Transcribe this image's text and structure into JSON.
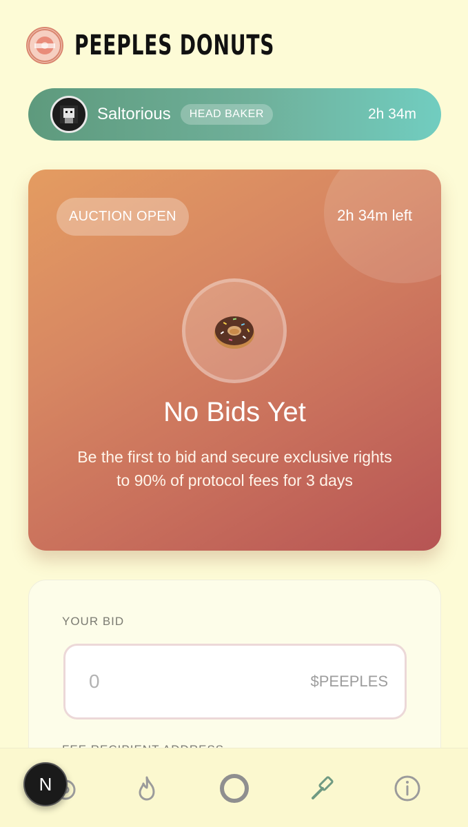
{
  "header": {
    "title": "PEEPLES DONUTS",
    "logo_icon": "donut-logo-icon"
  },
  "baker": {
    "name": "Saltorious",
    "role": "HEAD BAKER",
    "time": "2h 34m"
  },
  "auction": {
    "status": "AUCTION OPEN",
    "time_left": "2h 34m left",
    "heading": "No Bids Yet",
    "description": "Be the first to bid and secure exclusive rights to 90% of protocol fees for 3 days"
  },
  "bid_form": {
    "bid_label": "YOUR BID",
    "bid_placeholder": "0",
    "bid_unit": "$PEEPLES",
    "fee_label": "FEE RECIPIENT ADDRESS"
  },
  "nav": {
    "items": [
      {
        "icon": "donut-nav-icon"
      },
      {
        "icon": "flame-icon"
      },
      {
        "icon": "ring-icon"
      },
      {
        "icon": "gavel-icon"
      },
      {
        "icon": "info-icon"
      }
    ],
    "badge": "N"
  },
  "colors": {
    "background": "#fdfbd6",
    "accent_green": "#5e9a7d",
    "accent_orange": "#e49c61"
  }
}
